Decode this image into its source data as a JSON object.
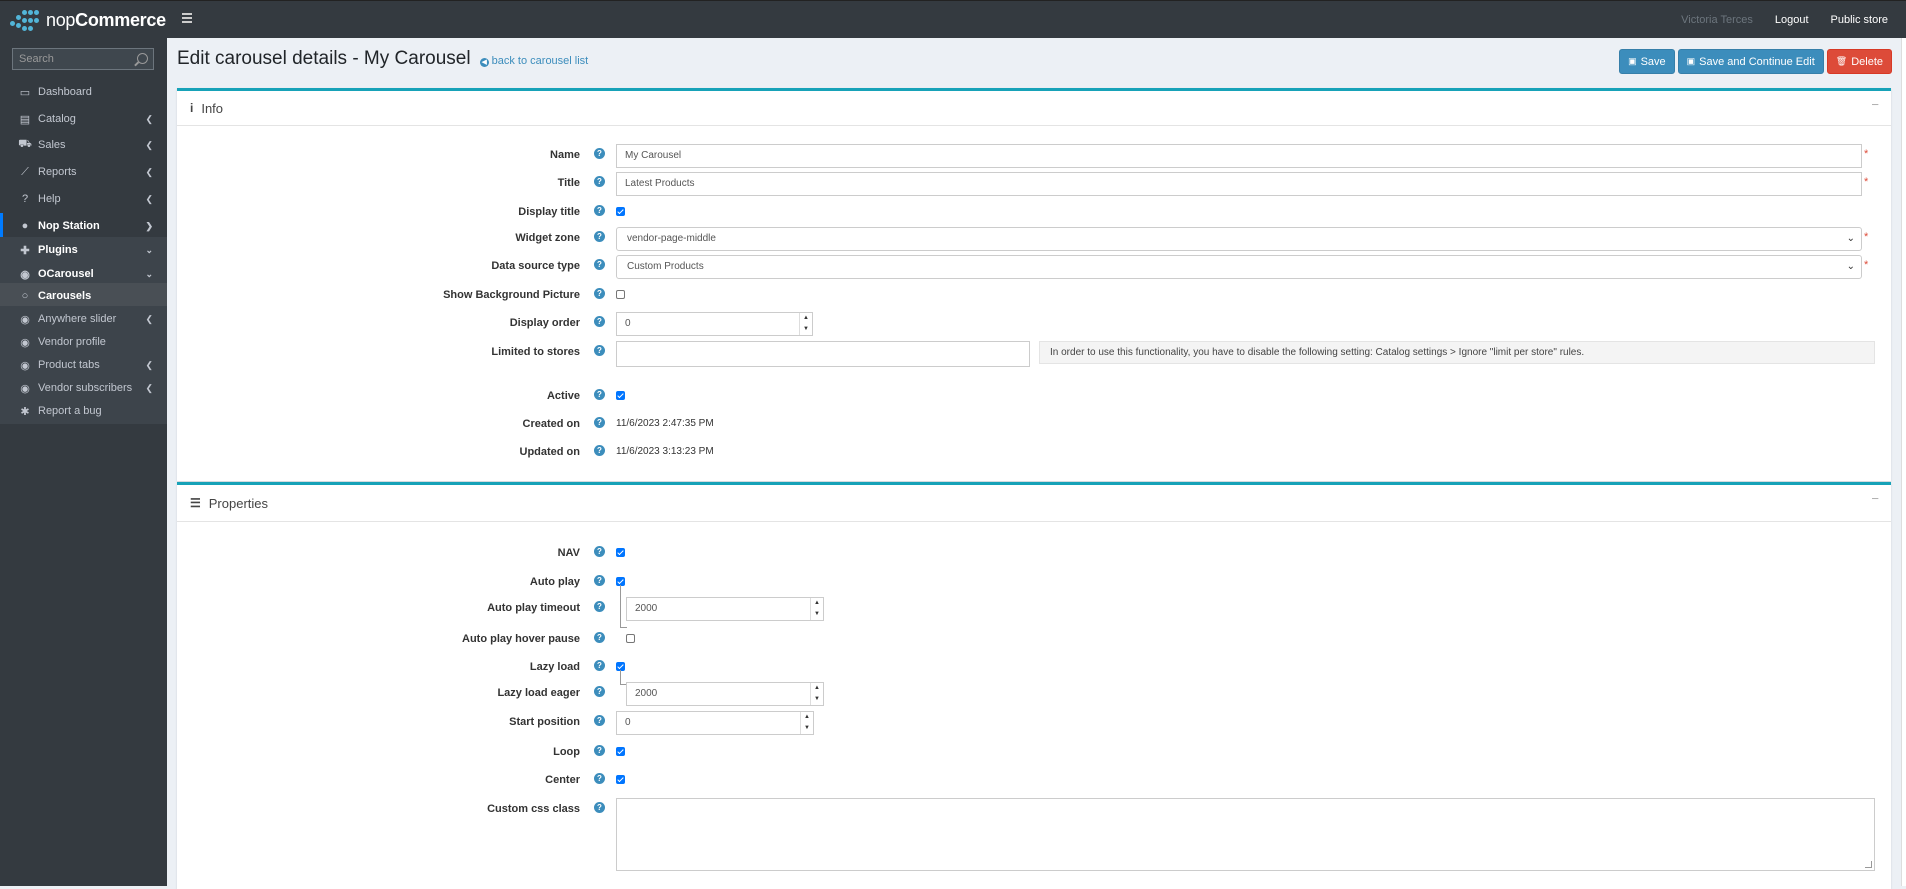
{
  "brand": {
    "name_light": "nop",
    "name_bold": "Commerce"
  },
  "topbar": {
    "user": "Victoria Terces",
    "logout": "Logout",
    "public_store": "Public store"
  },
  "sidebar": {
    "search_placeholder": "Search",
    "items": [
      {
        "label": "Dashboard"
      },
      {
        "label": "Catalog"
      },
      {
        "label": "Sales"
      },
      {
        "label": "Reports"
      },
      {
        "label": "Help"
      },
      {
        "label": "Nop Station"
      },
      {
        "label": "Plugins"
      },
      {
        "label": "OCarousel"
      },
      {
        "label": "Carousels"
      },
      {
        "label": "Anywhere slider"
      },
      {
        "label": "Vendor profile"
      },
      {
        "label": "Product tabs"
      },
      {
        "label": "Vendor subscribers"
      },
      {
        "label": "Report a bug"
      }
    ]
  },
  "header": {
    "title": "Edit carousel details - My Carousel",
    "back_link": "back to carousel list",
    "save": "Save",
    "save_continue": "Save and Continue Edit",
    "delete": "Delete"
  },
  "info": {
    "title": "Info",
    "name_label": "Name",
    "name_value": "My Carousel",
    "title_label": "Title",
    "title_value": "Latest Products",
    "display_title_label": "Display title",
    "display_title": true,
    "widget_zone_label": "Widget zone",
    "widget_zone_value": "vendor-page-middle",
    "data_source_label": "Data source type",
    "data_source_value": "Custom Products",
    "show_bg_label": "Show Background Picture",
    "show_bg": false,
    "display_order_label": "Display order",
    "display_order_value": "0",
    "limited_label": "Limited to stores",
    "limited_value": "",
    "limited_note": "In order to use this functionality, you have to disable the following setting: Catalog settings > Ignore \"limit per store\" rules.",
    "active_label": "Active",
    "active": true,
    "created_label": "Created on",
    "created_value": "11/6/2023 2:47:35 PM",
    "updated_label": "Updated on",
    "updated_value": "11/6/2023 3:13:23 PM"
  },
  "properties": {
    "title": "Properties",
    "nav_label": "NAV",
    "nav": true,
    "autoplay_label": "Auto play",
    "autoplay": true,
    "autoplay_timeout_label": "Auto play timeout",
    "autoplay_timeout_value": "2000",
    "autoplay_hover_label": "Auto play hover pause",
    "autoplay_hover": false,
    "lazyload_label": "Lazy load",
    "lazyload": true,
    "lazyload_eager_label": "Lazy load eager",
    "lazyload_eager_value": "2000",
    "start_position_label": "Start position",
    "start_position_value": "0",
    "loop_label": "Loop",
    "loop": true,
    "center_label": "Center",
    "center": true,
    "custom_css_label": "Custom css class",
    "custom_css_value": ""
  }
}
